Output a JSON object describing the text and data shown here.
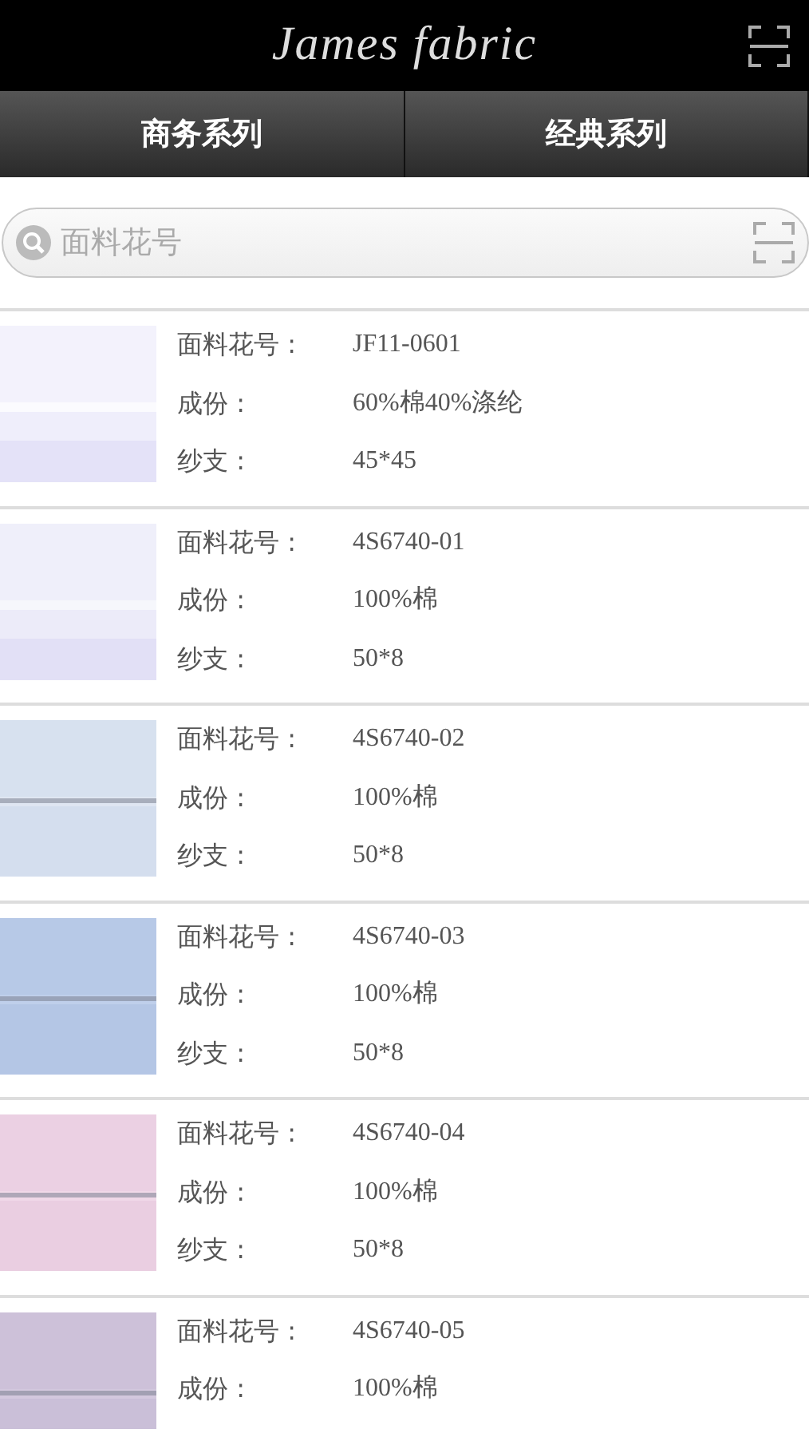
{
  "header": {
    "title": "James fabric"
  },
  "tabs": [
    {
      "label": "商务系列"
    },
    {
      "label": "经典系列"
    }
  ],
  "search": {
    "placeholder": "面料花号"
  },
  "items": [
    {
      "fields": [
        {
          "label": "面料花号 :",
          "value": "JF11-0601"
        },
        {
          "label": "成份 :",
          "value": "60%棉40%涤纶"
        },
        {
          "label": "纱支 :",
          "value": "45*45"
        }
      ]
    },
    {
      "fields": [
        {
          "label": "面料花号 :",
          "value": "4S6740-01"
        },
        {
          "label": "成份 :",
          "value": "100%棉"
        },
        {
          "label": "纱支 :",
          "value": "50*8"
        }
      ]
    },
    {
      "fields": [
        {
          "label": "面料花号 :",
          "value": "4S6740-02"
        },
        {
          "label": "成份 :",
          "value": "100%棉"
        },
        {
          "label": "纱支 :",
          "value": "50*8"
        }
      ]
    },
    {
      "fields": [
        {
          "label": "面料花号 :",
          "value": "4S6740-03"
        },
        {
          "label": "成份 :",
          "value": "100%棉"
        },
        {
          "label": "纱支 :",
          "value": "50*8"
        }
      ]
    },
    {
      "fields": [
        {
          "label": "面料花号 :",
          "value": "4S6740-04"
        },
        {
          "label": "成份 :",
          "value": "100%棉"
        },
        {
          "label": "纱支 :",
          "value": "50*8"
        }
      ]
    },
    {
      "fields": [
        {
          "label": "面料花号 :",
          "value": "4S6740-05"
        },
        {
          "label": "成份 :",
          "value": "100%棉"
        }
      ]
    }
  ]
}
